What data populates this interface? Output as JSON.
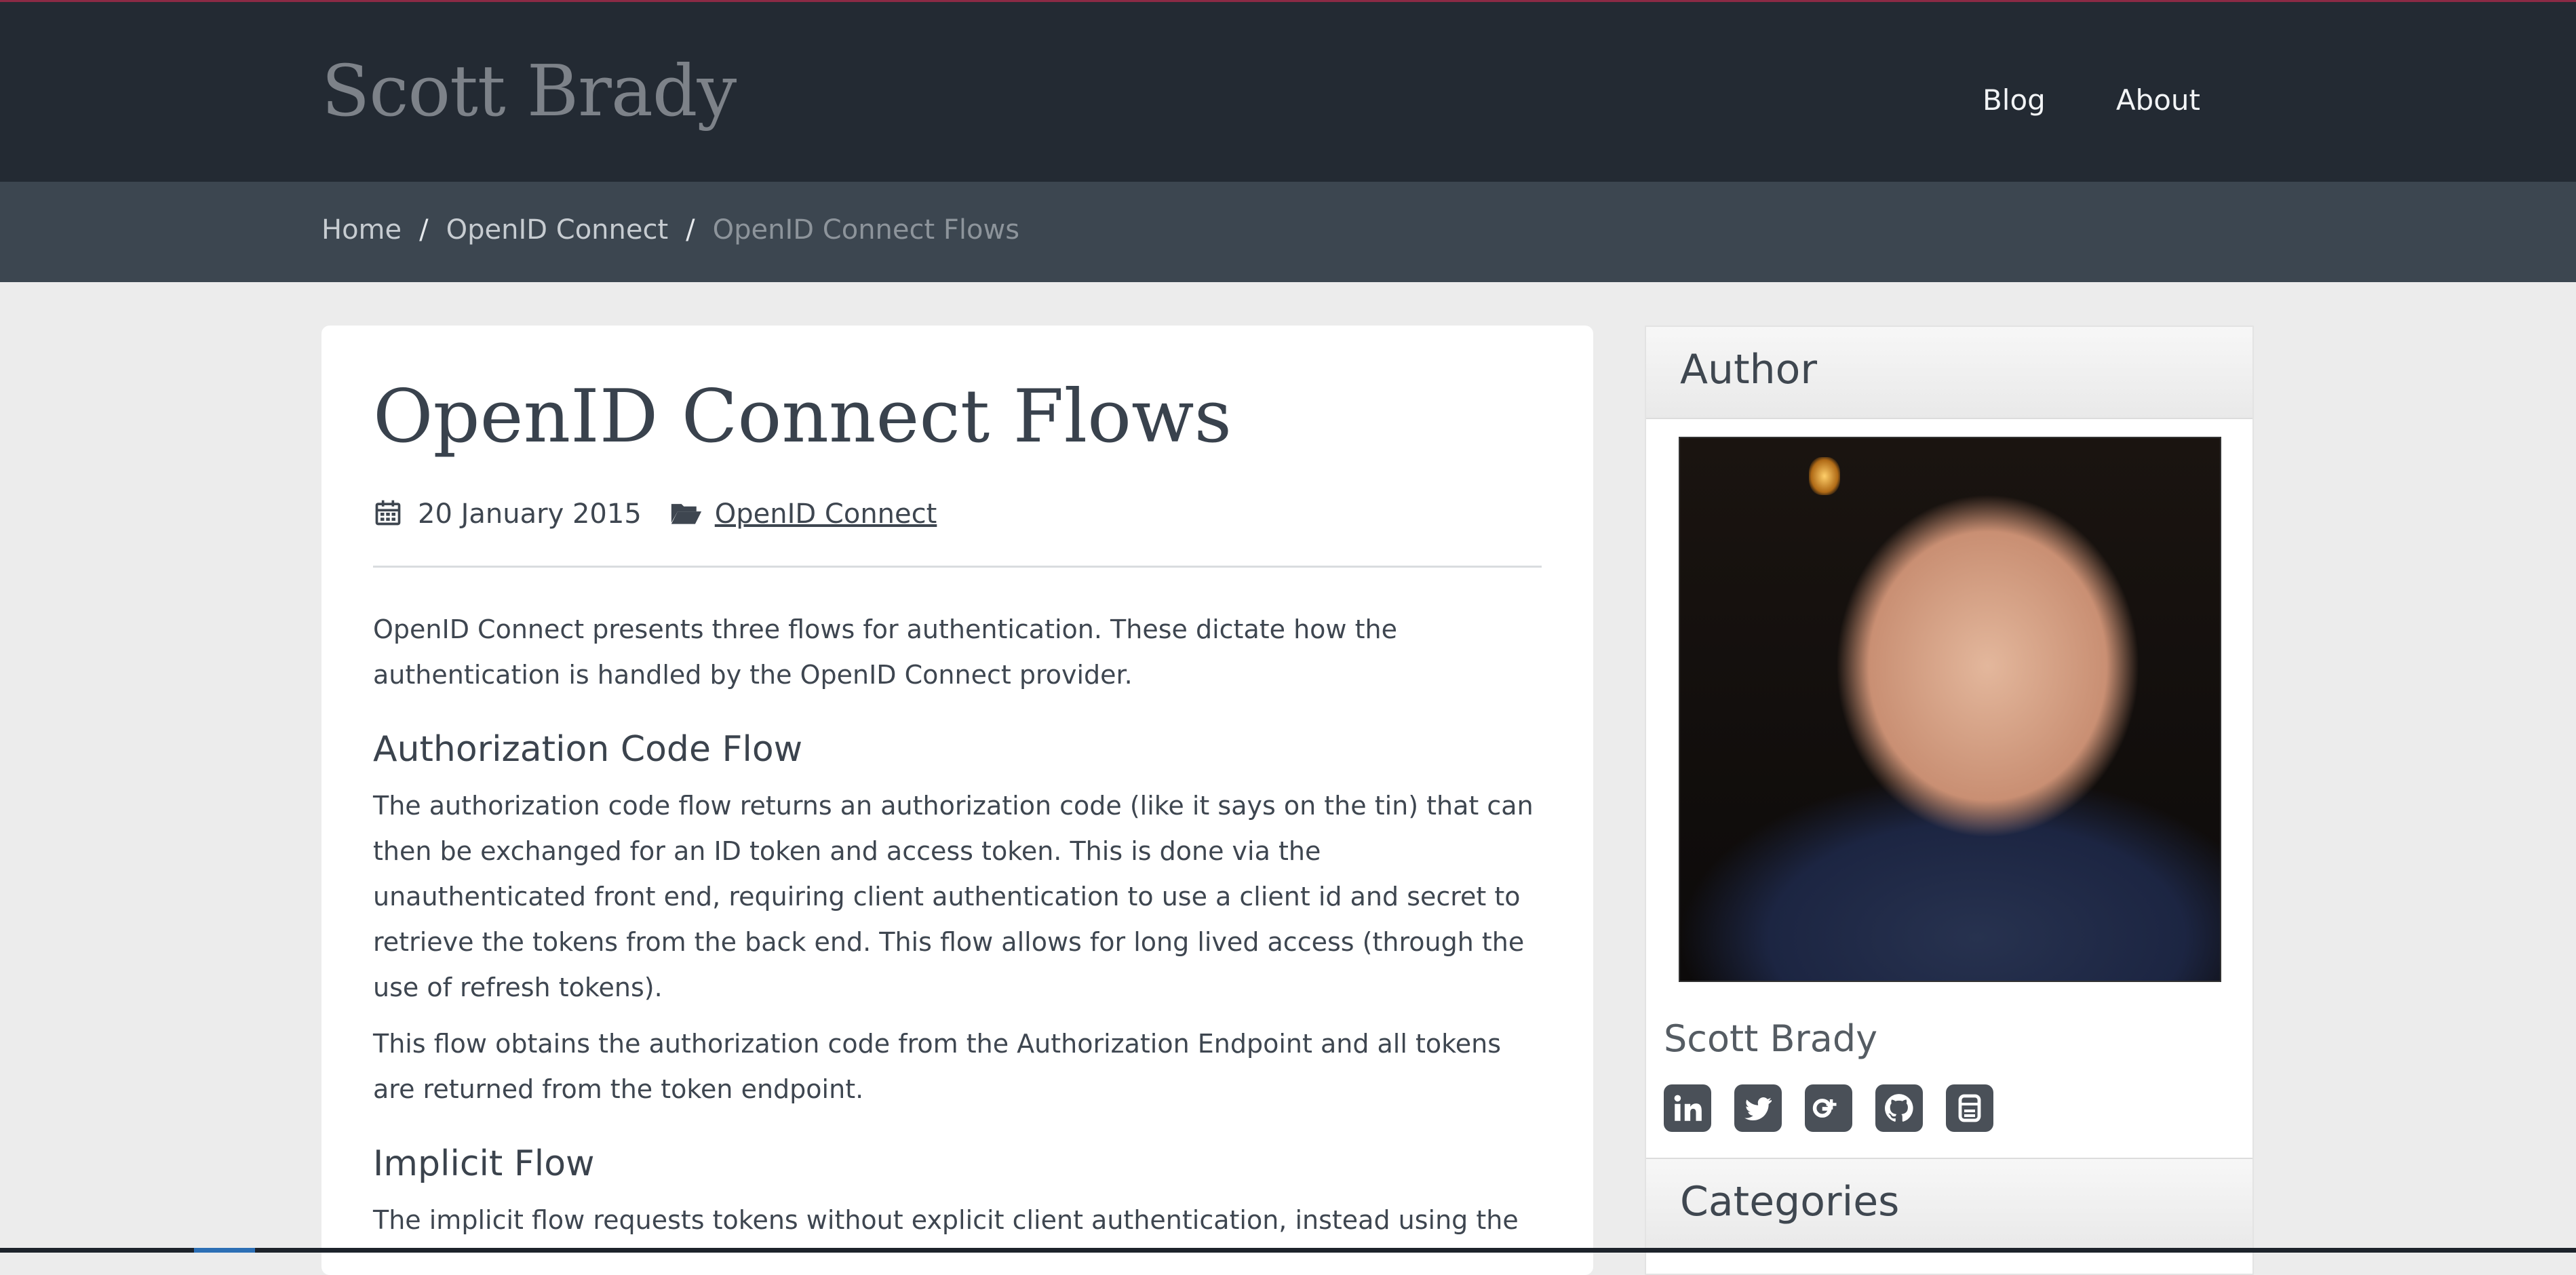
{
  "site": {
    "brand": "Scott Brady"
  },
  "nav": {
    "items": [
      "Blog",
      "About"
    ]
  },
  "breadcrumb": {
    "home": "Home",
    "section": "OpenID Connect",
    "current": "OpenID Connect Flows",
    "separator": "/"
  },
  "article": {
    "title": "OpenID Connect Flows",
    "date": "20 January 2015",
    "category": "OpenID Connect",
    "intro": "OpenID Connect presents three flows for authentication. These dictate how the authentication is handled by the OpenID Connect provider.",
    "sections": [
      {
        "heading": "Authorization Code Flow",
        "paragraphs": [
          "The authorization code flow returns an authorization code (like it says on the tin) that can then be exchanged for an ID token and access token. This is done via the unauthenticated front end, requiring client authentication to use a client id and secret to retrieve the tokens from the back end. This flow allows for long lived access (through the use of refresh tokens).",
          "This flow obtains the authorization code from the Authorization Endpoint and all tokens are returned from the token endpoint."
        ]
      },
      {
        "heading": "Implicit Flow",
        "paragraphs": [
          "The implicit flow requests tokens without explicit client authentication, instead using the"
        ]
      }
    ]
  },
  "sidebar": {
    "author_heading": "Author",
    "author_name": "Scott Brady",
    "socials": [
      "linkedin-icon",
      "twitter-icon",
      "google-plus-icon",
      "github-icon",
      "stackoverflow-icon"
    ],
    "categories_heading": "Categories"
  }
}
